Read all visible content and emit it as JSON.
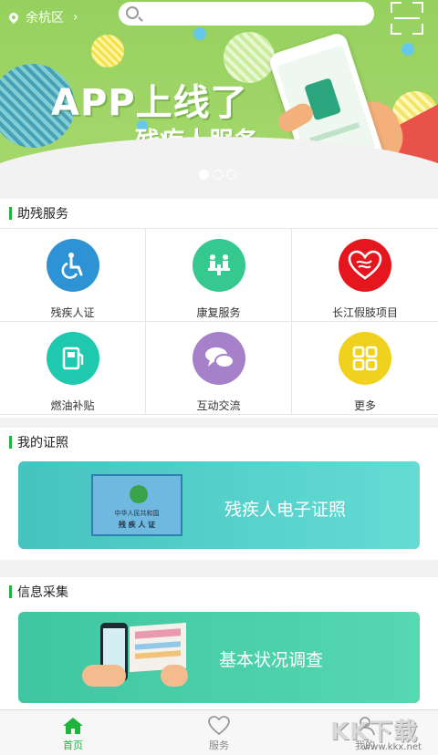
{
  "top_bar": {
    "location": "余杭区",
    "location_chevron": "›",
    "search_placeholder": ""
  },
  "banner": {
    "title": "APP上线了",
    "subtitle": "残疾人服务",
    "dots": {
      "count": 3,
      "active_index": 0
    }
  },
  "sections": {
    "assist": {
      "title": "助残服务",
      "items": [
        {
          "label": "残疾人证",
          "icon": "wheelchair-icon",
          "color": "#2e93d5"
        },
        {
          "label": "康复服务",
          "icon": "rehab-people-icon",
          "color": "#35c98f"
        },
        {
          "label": "长江假肢项目",
          "icon": "heart-logo-icon",
          "color": "#e5161e"
        },
        {
          "label": "燃油补贴",
          "icon": "fuel-pump-icon",
          "color": "#1fc9b0"
        },
        {
          "label": "互动交流",
          "icon": "chat-bubbles-icon",
          "color": "#a681c9"
        },
        {
          "label": "更多",
          "icon": "grid-more-icon",
          "color": "#f0d11d"
        }
      ]
    },
    "license": {
      "title": "我的证照",
      "card_text": "残疾人电子证照",
      "card_image_line1": "中华人民共和国",
      "card_image_line2": "残 疾 人 证"
    },
    "survey": {
      "title": "信息采集",
      "card_text": "基本状况调查"
    }
  },
  "tabbar": {
    "items": [
      {
        "label": "首页",
        "icon": "home-icon",
        "active": true
      },
      {
        "label": "服务",
        "icon": "heart-outline-icon",
        "active": false
      },
      {
        "label": "我的",
        "icon": "user-icon",
        "active": false
      }
    ]
  },
  "watermark": {
    "main": "KK下载",
    "url": "www.kkx.net"
  },
  "colors": {
    "accent_green": "#1fb53c",
    "banner_green": "#9fd567"
  }
}
